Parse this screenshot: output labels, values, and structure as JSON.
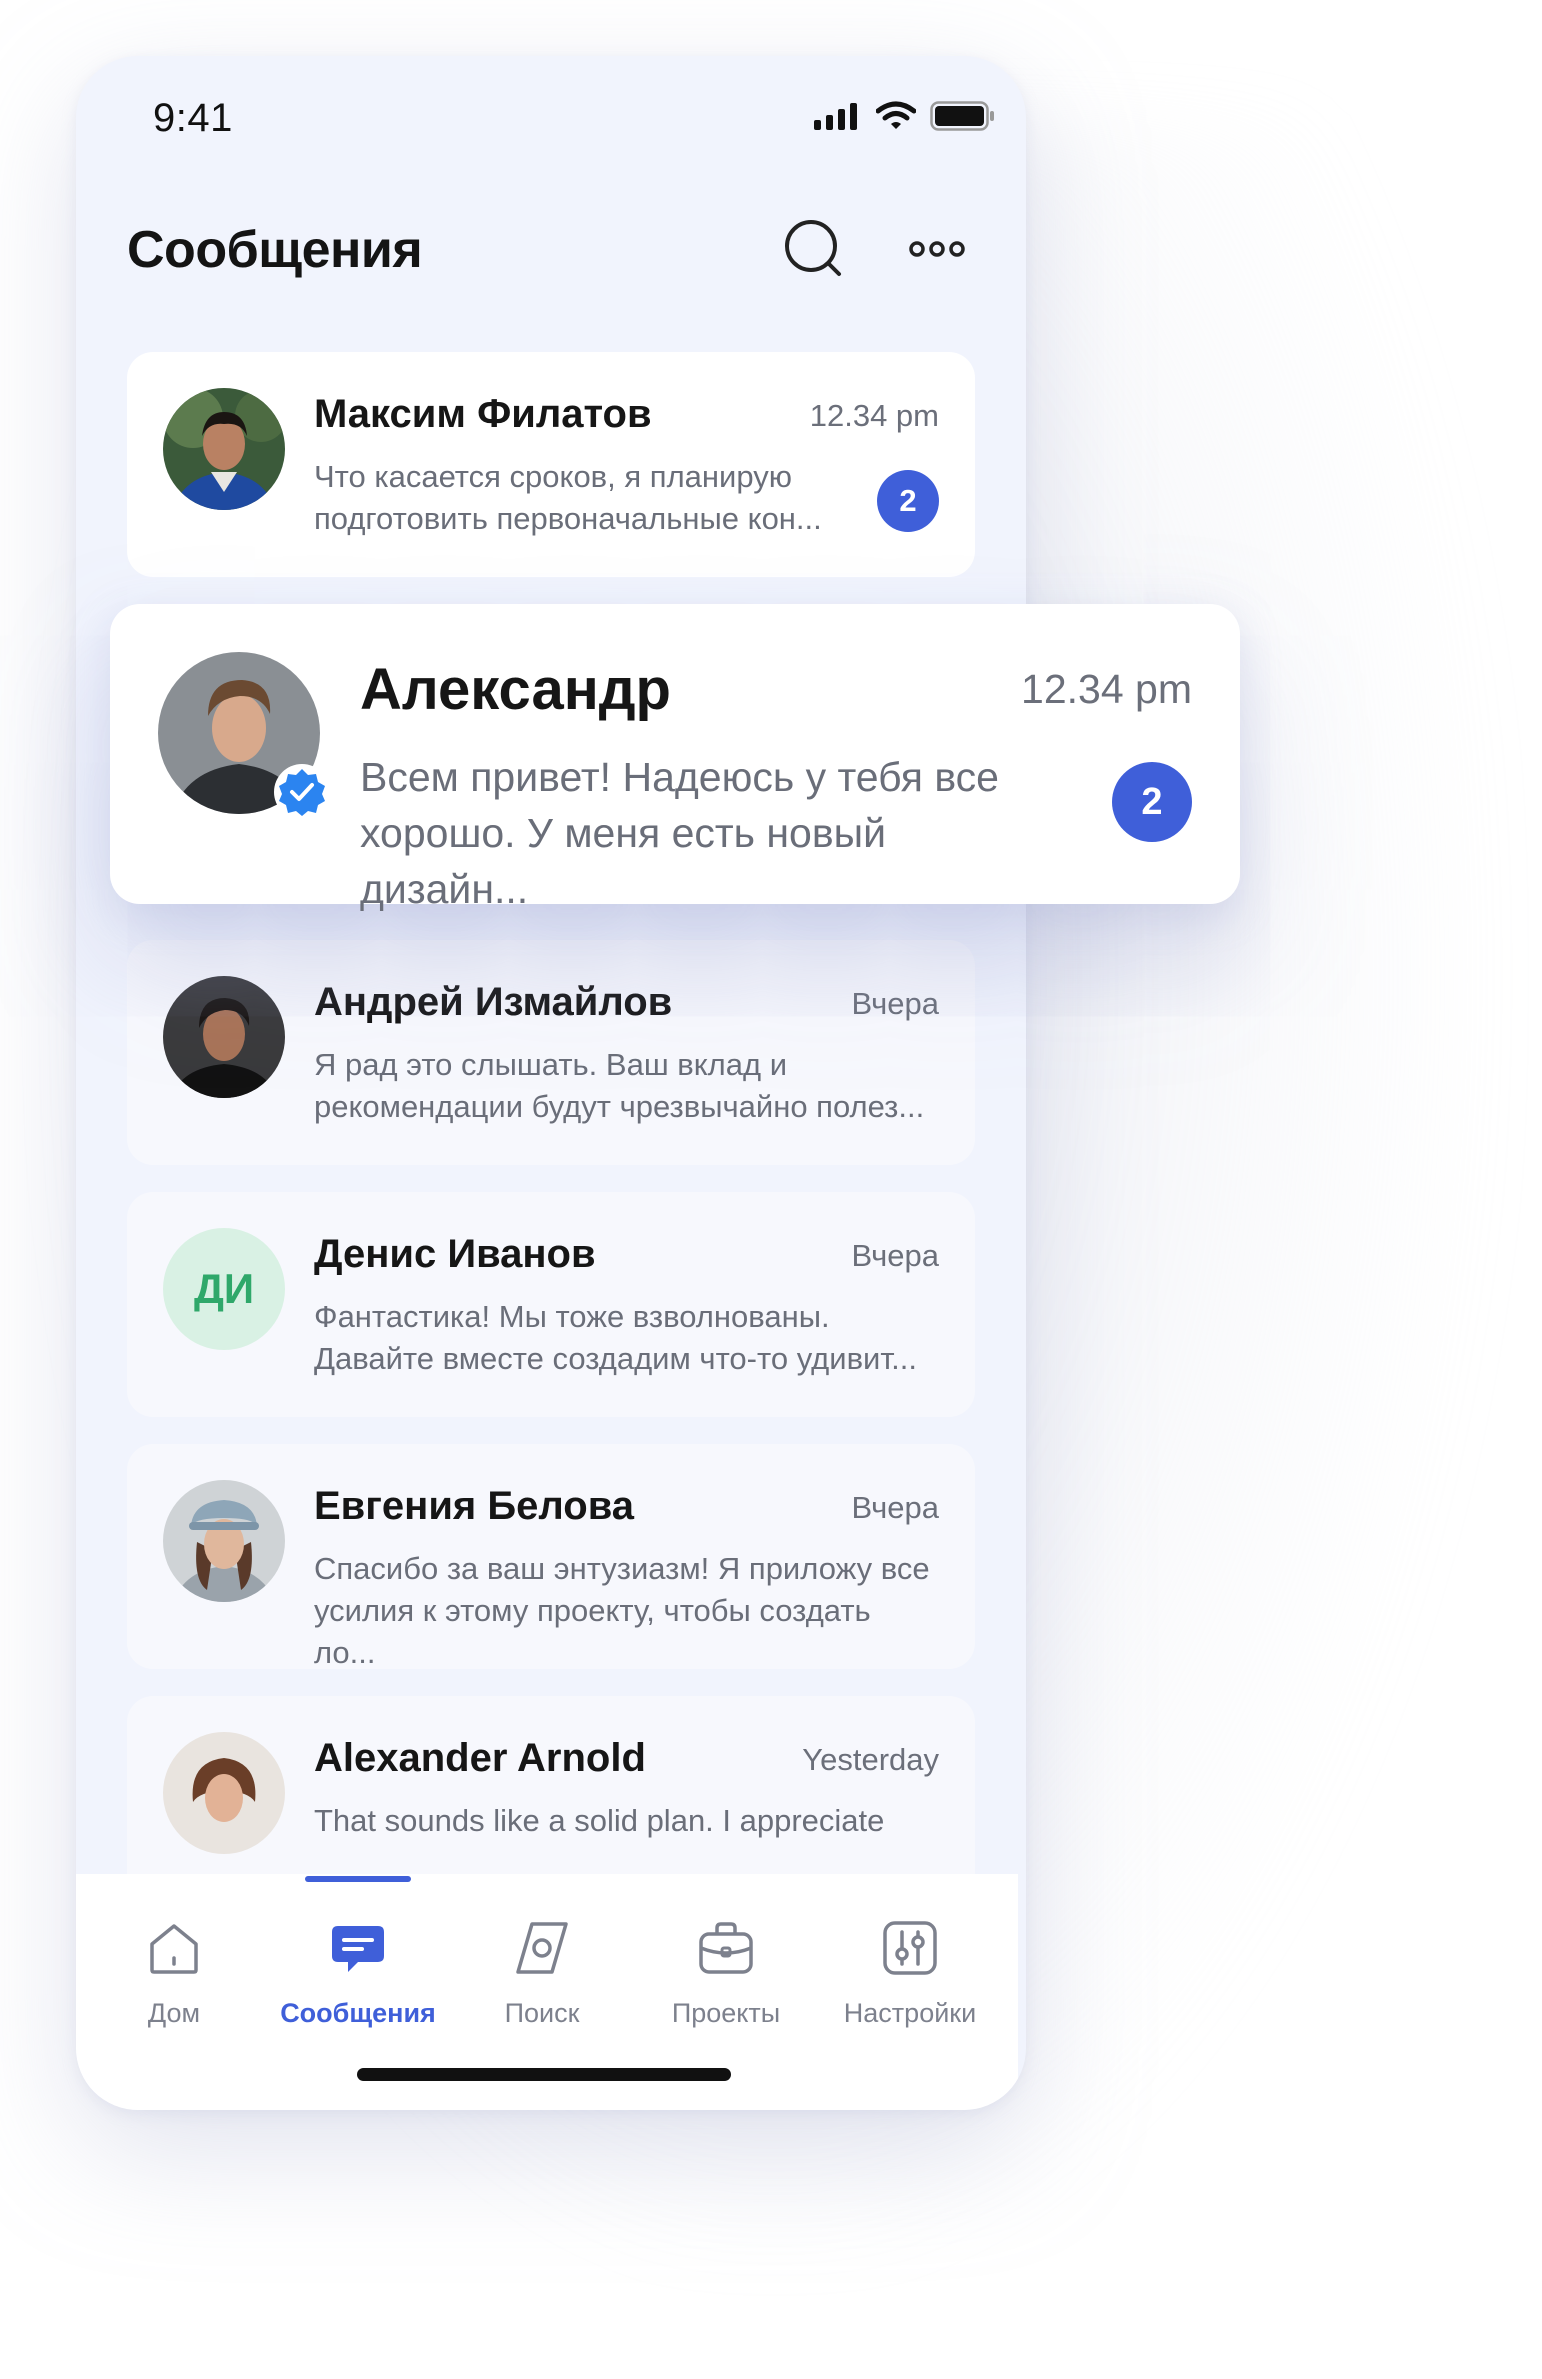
{
  "status": {
    "time": "9:41"
  },
  "header": {
    "title": "Сообщения"
  },
  "colors": {
    "accent": "#3f5fd9",
    "verified": "#2b84f0",
    "initials_bg": "#d9f1e4",
    "initials_fg": "#2fa86a"
  },
  "chats": [
    {
      "name": "Максим Филатов",
      "time": "12.34 pm",
      "preview": "Что касается сроков, я планирую подготовить первоначальные кон...",
      "unread": "2"
    },
    {
      "name": "Александр",
      "time": "12.34 pm",
      "preview": "Всем привет! Надеюсь у тебя все хорошо. У меня есть новый дизайн...",
      "unread": "2",
      "verified": true
    },
    {
      "name": "Андрей Измайлов",
      "time": "Вчера",
      "preview": "Я рад это слышать. Ваш вклад и рекомендации будут чрезвычайно полез..."
    },
    {
      "name": "Денис Иванов",
      "time": "Вчера",
      "preview": "Фантастика! Мы тоже взволнованы. Давайте вместе создадим что-то удивит...",
      "initials": "ДИ"
    },
    {
      "name": "Евгения  Белова",
      "time": "Вчера",
      "preview": "Спасибо за ваш энтузиазм! Я приложу все усилия к этому проекту, чтобы создать ло..."
    },
    {
      "name": "Alexander Arnold",
      "time": "Yesterday",
      "preview": "That sounds like a solid plan. I appreciate"
    }
  ],
  "nav": [
    {
      "label": "Дом",
      "icon": "home-icon"
    },
    {
      "label": "Сообщения",
      "icon": "messages-icon",
      "active": true
    },
    {
      "label": "Поиск",
      "icon": "explore-icon"
    },
    {
      "label": "Проекты",
      "icon": "briefcase-icon"
    },
    {
      "label": "Настройки",
      "icon": "settings-icon"
    }
  ]
}
